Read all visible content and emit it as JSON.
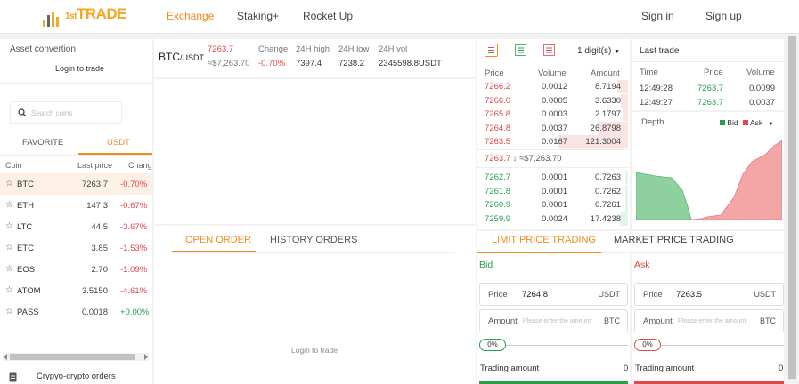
{
  "header": {
    "logo_text_1": "1st",
    "logo_text_2": "TRADE",
    "nav": {
      "exchange": "Exchange",
      "staking": "Staking+",
      "rocket": "Rocket Up",
      "signin": "Sign in",
      "signup": "Sign up"
    }
  },
  "left": {
    "title": "Asset convertion",
    "login": "Login to trade",
    "search_placeholder": "Search coins",
    "tabs": {
      "favorite": "FAVORITE",
      "usdt": "USDT"
    },
    "columns": {
      "coin": "Coin",
      "last_price": "Last price",
      "change": "Chang"
    },
    "coins": [
      {
        "name": "BTC",
        "price": "7263.7",
        "change": "-0.70%",
        "dir": "down"
      },
      {
        "name": "ETH",
        "price": "147.3",
        "change": "-0.67%",
        "dir": "down"
      },
      {
        "name": "LTC",
        "price": "44.5",
        "change": "-3.67%",
        "dir": "down"
      },
      {
        "name": "ETC",
        "price": "3.85",
        "change": "-1.53%",
        "dir": "down"
      },
      {
        "name": "EOS",
        "price": "2.70",
        "change": "-1.09%",
        "dir": "down"
      },
      {
        "name": "ATOM",
        "price": "3.5150",
        "change": "-4.61%",
        "dir": "down"
      },
      {
        "name": "PASS",
        "price": "0.0018",
        "change": "+0.00%",
        "dir": "up"
      }
    ],
    "crypto_orders": "Crypyo-crypto orders"
  },
  "ticker": {
    "pair": "BTC",
    "quote": "/USDT",
    "price": "7263.7",
    "approx": "≈$7,263.70",
    "change_label": "Change",
    "change": "-0.70%",
    "high_label": "24H high",
    "high": "7397.4",
    "low_label": "24H low",
    "low": "7238.2",
    "vol_label": "24H vol",
    "vol": "2345598.8USDT"
  },
  "orders": {
    "open": "OPEN ORDER",
    "history": "HISTORY ORDERS",
    "login": "Login to trade"
  },
  "book": {
    "digits": "1 digit(s)",
    "cols": {
      "price": "Price",
      "volume": "Volume",
      "amount": "Amount"
    },
    "asks": [
      {
        "price": "7266.2",
        "volume": "0.0012",
        "amount": "8.7194",
        "depth": 0.08
      },
      {
        "price": "7266.0",
        "volume": "0.0005",
        "amount": "3.6330",
        "depth": 0.05
      },
      {
        "price": "7265.8",
        "volume": "0.0003",
        "amount": "2.1797",
        "depth": 0.04
      },
      {
        "price": "7264.8",
        "volume": "0.0037",
        "amount": "26.8798",
        "depth": 0.22
      },
      {
        "price": "7263.5",
        "volume": "0.0167",
        "amount": "121.3004",
        "depth": 0.5
      }
    ],
    "mid_price": "7263.7",
    "mid_approx": "≈$7,263.70",
    "bids": [
      {
        "price": "7262.7",
        "volume": "0.0001",
        "amount": "0.7263",
        "depth": 0.02
      },
      {
        "price": "7261.8",
        "volume": "0.0001",
        "amount": "0.7262",
        "depth": 0.02
      },
      {
        "price": "7260.9",
        "volume": "0.0001",
        "amount": "0.7261",
        "depth": 0.02
      },
      {
        "price": "7259.9",
        "volume": "0.0024",
        "amount": "17.4238",
        "depth": 0.06
      }
    ]
  },
  "trades": {
    "title": "Last trade",
    "cols": {
      "time": "Time",
      "price": "Price",
      "volume": "Volume"
    },
    "rows": [
      {
        "time": "12:49:28",
        "price": "7263.7",
        "volume": "0.0099"
      },
      {
        "time": "12:49:27",
        "price": "7263.7",
        "volume": "0.0037"
      }
    ]
  },
  "depth": {
    "title": "Depth",
    "bid": "Bid",
    "ask": "Ask"
  },
  "trading": {
    "tab_limit": "LIMIT PRICE TRADING",
    "tab_market": "MARKET PRICE TRADING",
    "bid": {
      "title": "Bid",
      "price_label": "Price",
      "price": "7264.8",
      "unit": "USDT",
      "amount_label": "Amount",
      "amount_ph": "Please enter the amount",
      "amount_unit": "BTC",
      "pct": "0%",
      "trading_amount": "Trading amount",
      "trading_value": "0"
    },
    "ask": {
      "title": "Ask",
      "price_label": "Price",
      "price": "7263.5",
      "unit": "USDT",
      "amount_label": "Amount",
      "amount_ph": "Please enter the amount",
      "amount_unit": "BTC",
      "pct": "0%",
      "trading_amount": "Trading amount",
      "trading_value": "0"
    }
  },
  "colors": {
    "accent": "#f08c1e",
    "up": "#27a04b",
    "down": "#e0484a"
  }
}
